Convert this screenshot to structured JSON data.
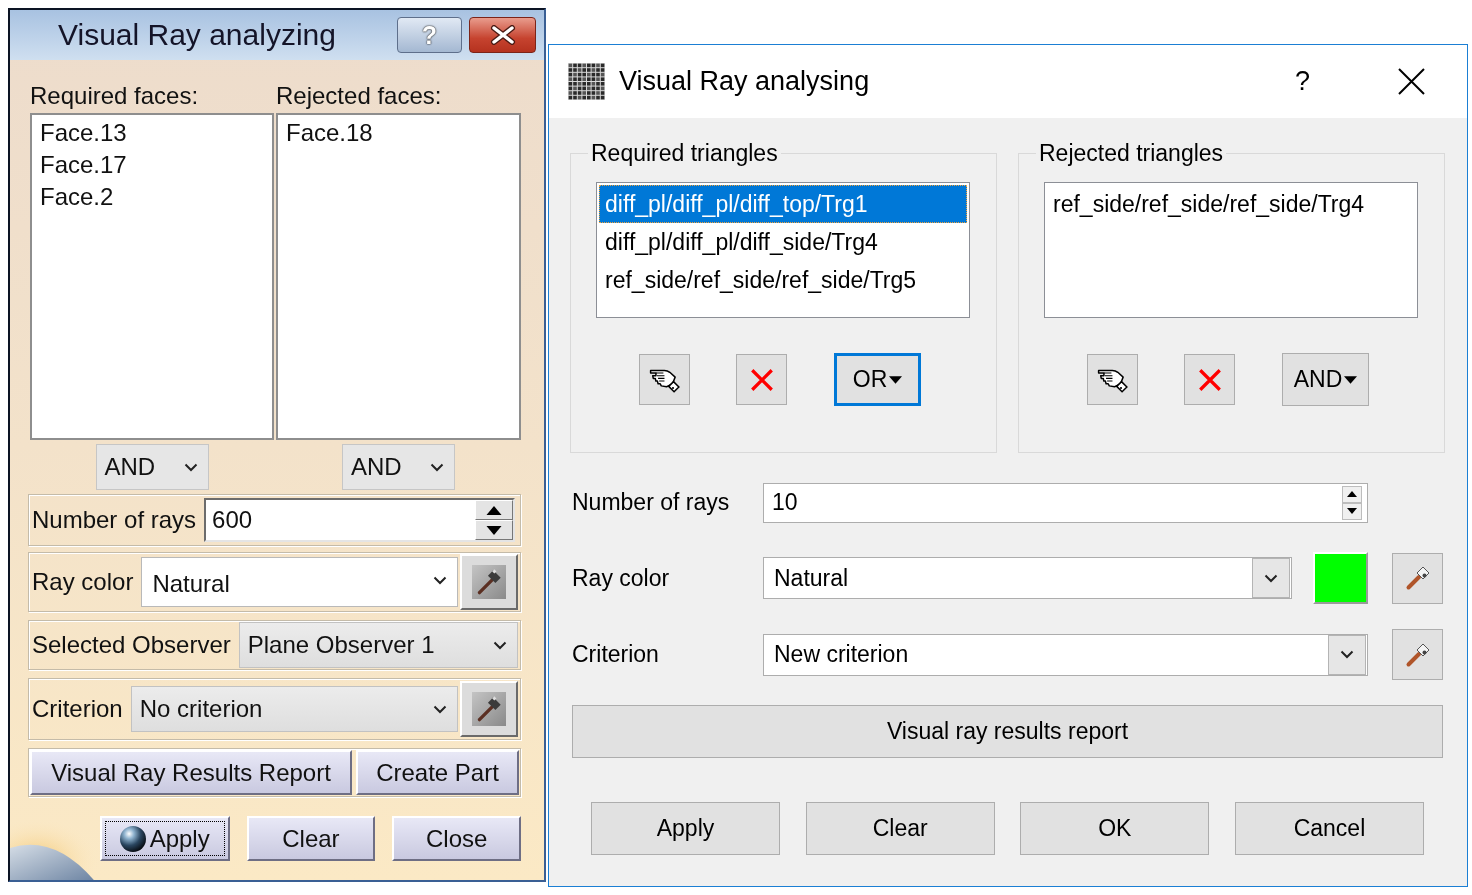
{
  "classic_dialog": {
    "title": "Visual Ray analyzing",
    "help_button": "?",
    "face_lists": [
      {
        "label": "Required faces:",
        "items": [
          {
            "text": "Face.13",
            "selected": false
          },
          {
            "text": "Face.17",
            "selected": false
          },
          {
            "text": "Face.2",
            "selected": false
          }
        ],
        "operator": "AND"
      },
      {
        "label": "Rejected faces:",
        "items": [
          {
            "text": "Face.18",
            "selected": false
          }
        ],
        "operator": "AND"
      }
    ],
    "fields": [
      {
        "kind": "spin",
        "label": "Number of rays",
        "value": "600"
      },
      {
        "kind": "combo",
        "label": "Ray color",
        "value": "Natural",
        "editable": true,
        "tool": true
      },
      {
        "kind": "combo",
        "label": "Selected Observer",
        "value": "Plane Observer 1",
        "editable": false,
        "tool": false
      },
      {
        "kind": "combo",
        "label": "Criterion",
        "value": "No criterion",
        "editable": false,
        "tool": true
      }
    ],
    "actions": [
      "Visual Ray Results Report",
      "Create Part"
    ],
    "buttons": [
      {
        "kind": "icon",
        "label": "Apply",
        "focused": true
      },
      {
        "kind": "text",
        "label": "Clear",
        "focused": false
      },
      {
        "kind": "text",
        "label": "Close",
        "focused": false
      }
    ]
  },
  "modern_dialog": {
    "title": "Visual Ray analysing",
    "help_button": "?",
    "groups": [
      {
        "label": "Required triangles",
        "items": [
          {
            "text": "diff_pl/diff_pl/diff_top/Trg1",
            "selected": true
          },
          {
            "text": "diff_pl/diff_pl/diff_side/Trg4",
            "selected": false
          },
          {
            "text": "ref_side/ref_side/ref_side/Trg5",
            "selected": false
          }
        ],
        "operator": "OR",
        "operator_focused": true
      },
      {
        "label": "Rejected triangles",
        "items": [
          {
            "text": "ref_side/ref_side/ref_side/Trg4",
            "selected": false
          }
        ],
        "operator": "AND",
        "operator_focused": false
      }
    ],
    "fields": [
      {
        "kind": "spin",
        "label": "Number of rays",
        "value": "10"
      },
      {
        "kind": "combo",
        "label": "Ray color",
        "value": "Natural",
        "color": "#00ff00",
        "tool": true
      },
      {
        "kind": "combo",
        "label": "Criterion",
        "value": "New criterion",
        "tool": true
      }
    ],
    "report_button": "Visual ray results report",
    "buttons": [
      "Apply",
      "Clear",
      "OK",
      "Cancel"
    ]
  }
}
